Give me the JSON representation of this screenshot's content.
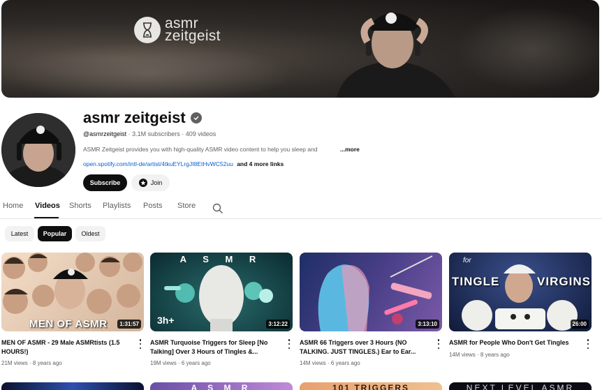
{
  "banner": {
    "logo_line1": "asmr",
    "logo_line2": "zeitgeist"
  },
  "channel": {
    "name": "asmr zeitgeist",
    "handle": "@asmrzeitgeist",
    "subscribers": "3.1M subscribers",
    "videos": "409 videos",
    "description": "ASMR Zeitgeist provides you with high-quality ASMR video content to help you sleep and",
    "more_label": "...more",
    "link_url": "open.spotify.com/intl-de/artist/4tkuEYLrgJI8EtHvWC52uu",
    "link_extra": "and 4 more links"
  },
  "buttons": {
    "subscribe": "Subscribe",
    "join": "Join"
  },
  "tabs": [
    {
      "label": "Home"
    },
    {
      "label": "Videos"
    },
    {
      "label": "Shorts"
    },
    {
      "label": "Playlists"
    },
    {
      "label": "Posts"
    },
    {
      "label": "Store"
    }
  ],
  "chips": [
    {
      "label": "Latest"
    },
    {
      "label": "Popular"
    },
    {
      "label": "Oldest"
    }
  ],
  "videos": [
    {
      "title": "MEN OF ASMR - 29 Male ASMRtists (1.5 HOURS!)",
      "duration": "1:31:57",
      "views": "21M views",
      "age": "8 years ago",
      "overlay": "MEN OF ASMR"
    },
    {
      "title": "ASMR Turquoise Triggers for Sleep [No Talking] Over 3 Hours of Tingles &...",
      "duration": "3:12:22",
      "views": "19M views",
      "age": "6 years ago",
      "overlay": "A S M R",
      "badge": "3h+"
    },
    {
      "title": "ASMR 66 Triggers over 3 Hours (NO TALKING. JUST TINGLES.) Ear to Ear...",
      "duration": "3:13:10",
      "views": "14M views",
      "age": "6 years ago"
    },
    {
      "title": "ASMR for People Who Don't Get Tingles",
      "duration": "26:00",
      "views": "14M views",
      "age": "8 years ago",
      "overlay_small": "for",
      "overlay": "TINGLE VIRGINS"
    }
  ],
  "row2": [
    {
      "text": ""
    },
    {
      "text": "A S M R"
    },
    {
      "text": "101 TRIGGERS"
    },
    {
      "text": "NEXT LEVEL ASMR"
    }
  ],
  "colors": {
    "link": "#065fd4",
    "text": "#0f0f0f",
    "muted": "#606060"
  }
}
